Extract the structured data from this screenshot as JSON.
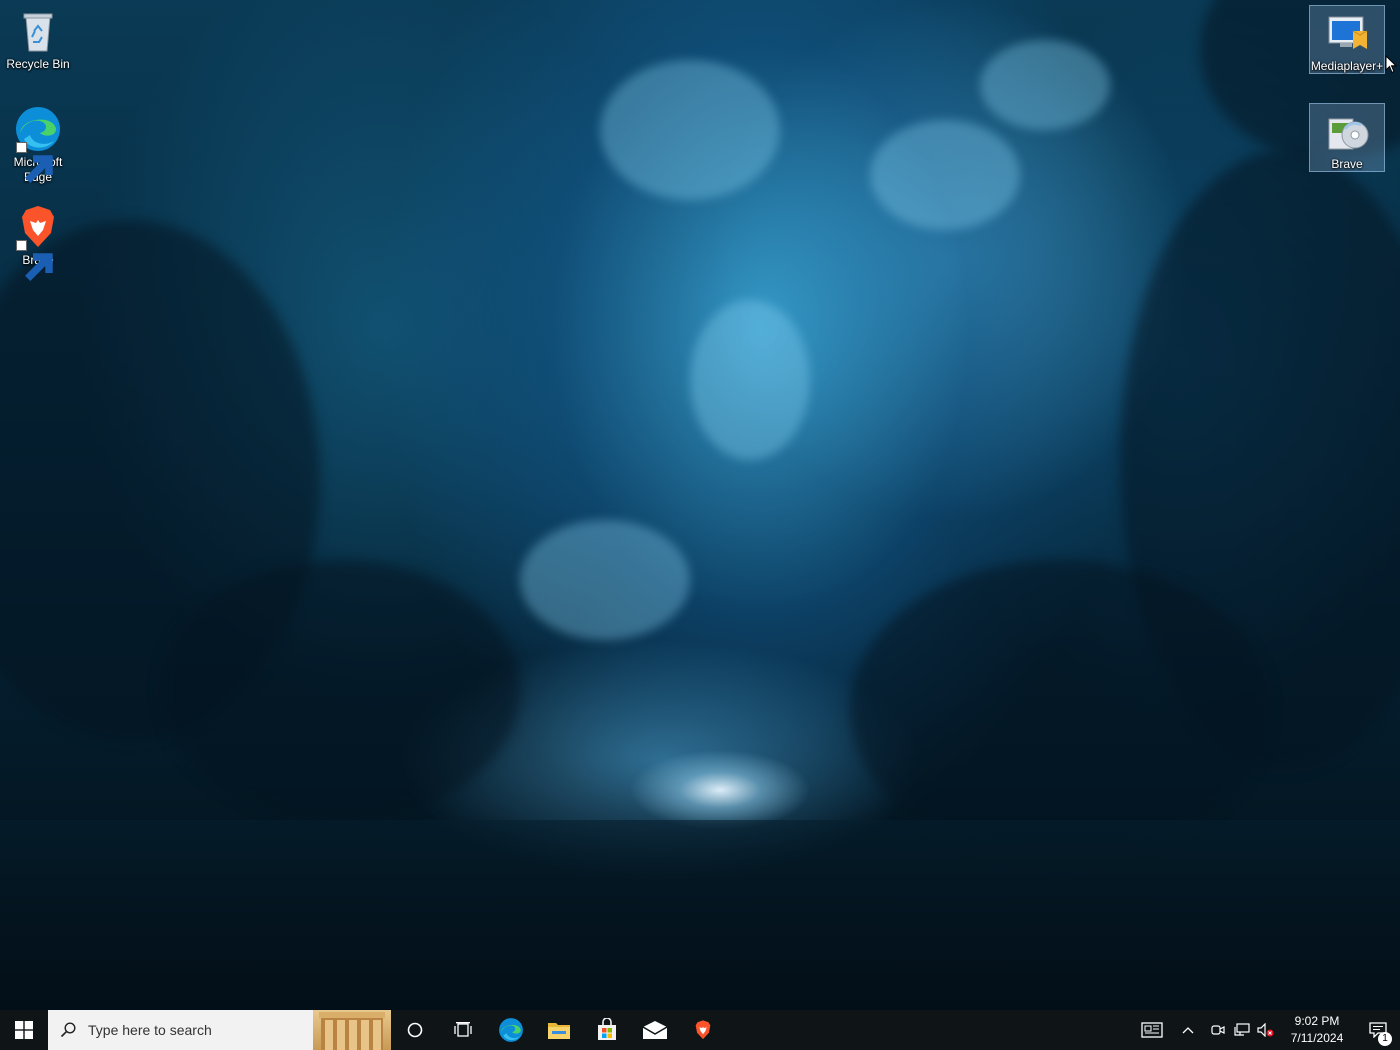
{
  "desktop_icons_left": [
    {
      "label": "Recycle Bin",
      "icon": "recycle-bin-icon"
    },
    {
      "label": "Microsoft Edge",
      "icon": "edge-icon"
    },
    {
      "label": "Brave",
      "icon": "brave-icon"
    }
  ],
  "desktop_icons_right": [
    {
      "label": "Mediaplayer+",
      "icon": "mediaplayer-icon",
      "selected": true
    },
    {
      "label": "Brave",
      "icon": "installer-cd-icon",
      "selected": true
    }
  ],
  "taskbar": {
    "search_placeholder": "Type here to search",
    "pinned": [
      "cortana-icon",
      "task-view-icon",
      "edge-icon",
      "file-explorer-icon",
      "store-icon",
      "mail-icon",
      "brave-icon"
    ]
  },
  "tray": {
    "icons": [
      "news-icon",
      "chevron-up-icon",
      "meet-now-icon",
      "network-icon",
      "volume-muted-icon"
    ],
    "time": "9:02 PM",
    "date": "7/11/2024",
    "notification_count": "1"
  },
  "colors": {
    "taskbar": "#0f1417",
    "search_box": "#f2f2f2",
    "windows_logo": "#ffffff",
    "brave": "#fb542b",
    "edge": "#0c8fd8"
  }
}
